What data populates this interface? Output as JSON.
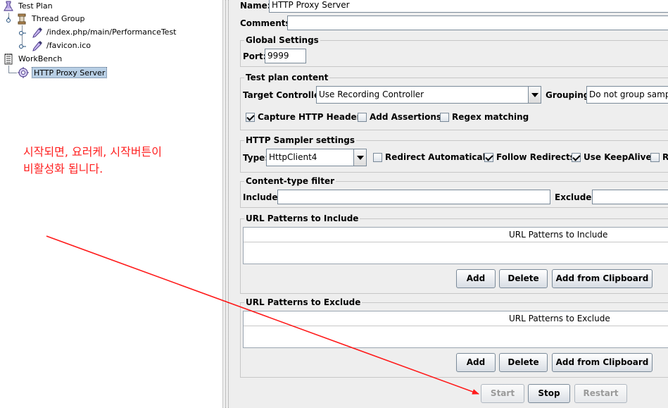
{
  "tree": {
    "items": [
      {
        "label": "Test Plan",
        "icon": "flask-icon"
      },
      {
        "label": "Thread Group",
        "icon": "spool-icon"
      },
      {
        "label": "/index.php/main/PerformanceTest",
        "icon": "pipette-icon"
      },
      {
        "label": "/favicon.ico",
        "icon": "pipette-icon"
      },
      {
        "label": "WorkBench",
        "icon": "notepad-icon"
      },
      {
        "label": "HTTP Proxy Server",
        "icon": "proxy-gear-icon"
      }
    ]
  },
  "form": {
    "name_label": "Name:",
    "name_value": "HTTP Proxy Server",
    "comments_label": "Comments:",
    "global": {
      "title": "Global Settings",
      "port_label": "Port:",
      "port_value": "9999"
    },
    "content": {
      "title": "Test plan content",
      "target_label": "Target Controller:",
      "target_value": "Use Recording Controller",
      "grouping_label": "Grouping:",
      "grouping_value": "Do not group sample",
      "capture_headers": {
        "label": "Capture HTTP Headers",
        "checked": true
      },
      "add_assertions": {
        "label": "Add Assertions",
        "checked": false
      },
      "regex_matching": {
        "label": "Regex matching",
        "checked": false
      }
    },
    "sampler": {
      "title": "HTTP Sampler settings",
      "type_label": "Type:",
      "type_value": "HttpClient4",
      "redirect_auto": {
        "label": "Redirect Automatically",
        "checked": false
      },
      "follow_redirects": {
        "label": "Follow Redirects",
        "checked": true
      },
      "keepalive": {
        "label": "Use KeepAlive",
        "checked": true
      },
      "cut_label": "R"
    },
    "filter": {
      "title": "Content-type filter",
      "include_label": "Include:",
      "exclude_label": "Exclude:"
    },
    "include_patterns": {
      "title": "URL Patterns to Include",
      "column": "URL Patterns to Include",
      "add": "Add",
      "delete": "Delete",
      "clipboard": "Add from Clipboard"
    },
    "exclude_patterns": {
      "title": "URL Patterns to Exclude",
      "column": "URL Patterns to Exclude",
      "add": "Add",
      "delete": "Delete",
      "clipboard": "Add from Clipboard"
    },
    "actions": {
      "start": "Start",
      "stop": "Stop",
      "restart": "Restart"
    }
  },
  "annotation": {
    "line1": "시작되면, 요러케, 시작버튼이",
    "line2": "비활성화 됩니다.",
    "color": "#ff2020"
  }
}
